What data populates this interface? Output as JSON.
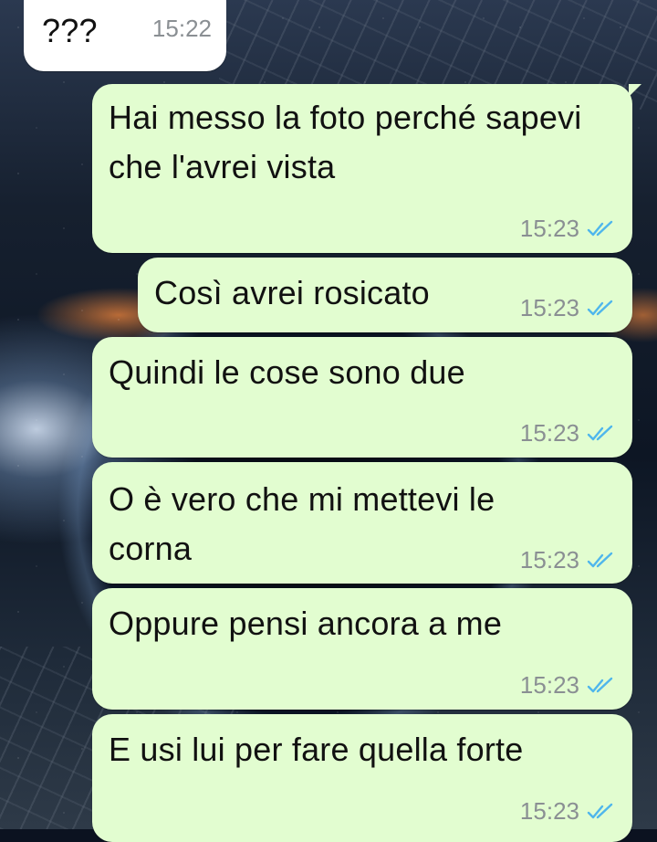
{
  "messages": [
    {
      "direction": "incoming",
      "text": "???",
      "time": "15:22"
    },
    {
      "direction": "outgoing",
      "text": "Hai messo la foto perché sapevi che l'avrei vista",
      "time": "15:23",
      "status": "read"
    },
    {
      "direction": "outgoing",
      "text": "Così avrei rosicato",
      "time": "15:23",
      "status": "read"
    },
    {
      "direction": "outgoing",
      "text": "Quindi le cose sono due",
      "time": "15:23",
      "status": "read"
    },
    {
      "direction": "outgoing",
      "text": "O è vero che mi mettevi le corna",
      "time": "15:23",
      "status": "read"
    },
    {
      "direction": "outgoing",
      "text": "Oppure pensi ancora a me",
      "time": "15:23",
      "status": "read"
    },
    {
      "direction": "outgoing",
      "text": "E usi lui per fare quella forte",
      "time": "15:23",
      "status": "read"
    }
  ],
  "colors": {
    "incoming_bubble": "#ffffff",
    "outgoing_bubble": "#e2fdd0",
    "read_ticks": "#4fb6ec",
    "timestamp": "#8a8f93"
  },
  "icons": {
    "read_status": "double-check-icon"
  }
}
